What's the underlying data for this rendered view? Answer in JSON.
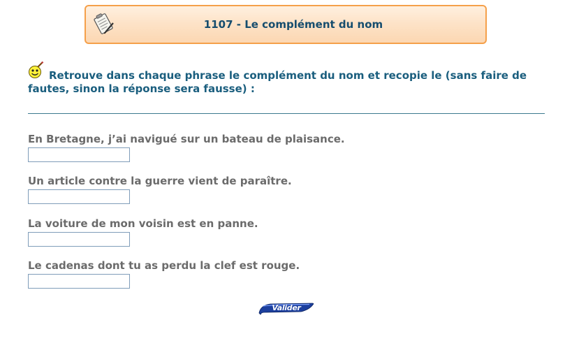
{
  "header": {
    "title": "1107 - Le complément du nom",
    "icon": "clipboard-pencil-icon"
  },
  "instructions": {
    "icon": "smiley-pencil-icon",
    "text": "Retrouve dans chaque phrase le complément du nom et recopie le (sans faire de fautes, sinon la réponse sera fausse) :"
  },
  "questions": [
    {
      "sentence": "En Bretagne, j’ai navigué sur un bateau de plaisance.",
      "answer": ""
    },
    {
      "sentence": "Un article contre la guerre vient de paraître.",
      "answer": ""
    },
    {
      "sentence": "La voiture de mon voisin est en panne.",
      "answer": ""
    },
    {
      "sentence": "Le cadenas dont tu as perdu la clef est rouge.",
      "answer": ""
    }
  ],
  "submit": {
    "label": "Valider"
  },
  "colors": {
    "title_border": "#f5a04a",
    "title_text": "#164d6e",
    "instruction_text": "#1a5e7e",
    "question_text": "#6b6b6b",
    "button": "#1c3f9e"
  }
}
